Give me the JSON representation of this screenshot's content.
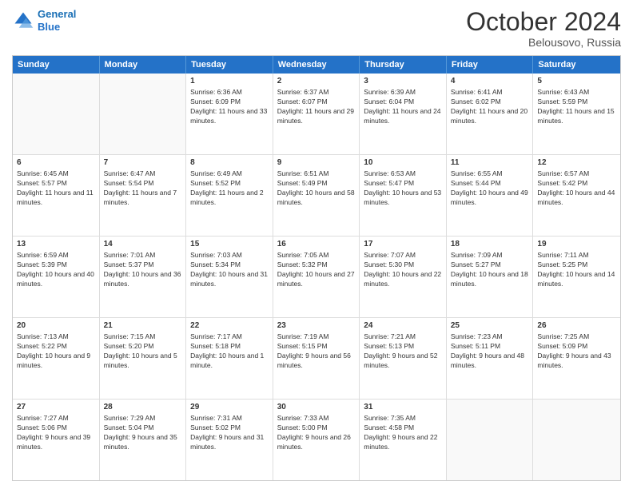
{
  "header": {
    "logo_line1": "General",
    "logo_line2": "Blue",
    "month": "October 2024",
    "location": "Belousovo, Russia"
  },
  "days_of_week": [
    "Sunday",
    "Monday",
    "Tuesday",
    "Wednesday",
    "Thursday",
    "Friday",
    "Saturday"
  ],
  "weeks": [
    [
      {
        "day": "",
        "sunrise": "",
        "sunset": "",
        "daylight": "",
        "empty": true
      },
      {
        "day": "",
        "sunrise": "",
        "sunset": "",
        "daylight": "",
        "empty": true
      },
      {
        "day": "1",
        "sunrise": "Sunrise: 6:36 AM",
        "sunset": "Sunset: 6:09 PM",
        "daylight": "Daylight: 11 hours and 33 minutes."
      },
      {
        "day": "2",
        "sunrise": "Sunrise: 6:37 AM",
        "sunset": "Sunset: 6:07 PM",
        "daylight": "Daylight: 11 hours and 29 minutes."
      },
      {
        "day": "3",
        "sunrise": "Sunrise: 6:39 AM",
        "sunset": "Sunset: 6:04 PM",
        "daylight": "Daylight: 11 hours and 24 minutes."
      },
      {
        "day": "4",
        "sunrise": "Sunrise: 6:41 AM",
        "sunset": "Sunset: 6:02 PM",
        "daylight": "Daylight: 11 hours and 20 minutes."
      },
      {
        "day": "5",
        "sunrise": "Sunrise: 6:43 AM",
        "sunset": "Sunset: 5:59 PM",
        "daylight": "Daylight: 11 hours and 15 minutes."
      }
    ],
    [
      {
        "day": "6",
        "sunrise": "Sunrise: 6:45 AM",
        "sunset": "Sunset: 5:57 PM",
        "daylight": "Daylight: 11 hours and 11 minutes."
      },
      {
        "day": "7",
        "sunrise": "Sunrise: 6:47 AM",
        "sunset": "Sunset: 5:54 PM",
        "daylight": "Daylight: 11 hours and 7 minutes."
      },
      {
        "day": "8",
        "sunrise": "Sunrise: 6:49 AM",
        "sunset": "Sunset: 5:52 PM",
        "daylight": "Daylight: 11 hours and 2 minutes."
      },
      {
        "day": "9",
        "sunrise": "Sunrise: 6:51 AM",
        "sunset": "Sunset: 5:49 PM",
        "daylight": "Daylight: 10 hours and 58 minutes."
      },
      {
        "day": "10",
        "sunrise": "Sunrise: 6:53 AM",
        "sunset": "Sunset: 5:47 PM",
        "daylight": "Daylight: 10 hours and 53 minutes."
      },
      {
        "day": "11",
        "sunrise": "Sunrise: 6:55 AM",
        "sunset": "Sunset: 5:44 PM",
        "daylight": "Daylight: 10 hours and 49 minutes."
      },
      {
        "day": "12",
        "sunrise": "Sunrise: 6:57 AM",
        "sunset": "Sunset: 5:42 PM",
        "daylight": "Daylight: 10 hours and 44 minutes."
      }
    ],
    [
      {
        "day": "13",
        "sunrise": "Sunrise: 6:59 AM",
        "sunset": "Sunset: 5:39 PM",
        "daylight": "Daylight: 10 hours and 40 minutes."
      },
      {
        "day": "14",
        "sunrise": "Sunrise: 7:01 AM",
        "sunset": "Sunset: 5:37 PM",
        "daylight": "Daylight: 10 hours and 36 minutes."
      },
      {
        "day": "15",
        "sunrise": "Sunrise: 7:03 AM",
        "sunset": "Sunset: 5:34 PM",
        "daylight": "Daylight: 10 hours and 31 minutes."
      },
      {
        "day": "16",
        "sunrise": "Sunrise: 7:05 AM",
        "sunset": "Sunset: 5:32 PM",
        "daylight": "Daylight: 10 hours and 27 minutes."
      },
      {
        "day": "17",
        "sunrise": "Sunrise: 7:07 AM",
        "sunset": "Sunset: 5:30 PM",
        "daylight": "Daylight: 10 hours and 22 minutes."
      },
      {
        "day": "18",
        "sunrise": "Sunrise: 7:09 AM",
        "sunset": "Sunset: 5:27 PM",
        "daylight": "Daylight: 10 hours and 18 minutes."
      },
      {
        "day": "19",
        "sunrise": "Sunrise: 7:11 AM",
        "sunset": "Sunset: 5:25 PM",
        "daylight": "Daylight: 10 hours and 14 minutes."
      }
    ],
    [
      {
        "day": "20",
        "sunrise": "Sunrise: 7:13 AM",
        "sunset": "Sunset: 5:22 PM",
        "daylight": "Daylight: 10 hours and 9 minutes."
      },
      {
        "day": "21",
        "sunrise": "Sunrise: 7:15 AM",
        "sunset": "Sunset: 5:20 PM",
        "daylight": "Daylight: 10 hours and 5 minutes."
      },
      {
        "day": "22",
        "sunrise": "Sunrise: 7:17 AM",
        "sunset": "Sunset: 5:18 PM",
        "daylight": "Daylight: 10 hours and 1 minute."
      },
      {
        "day": "23",
        "sunrise": "Sunrise: 7:19 AM",
        "sunset": "Sunset: 5:15 PM",
        "daylight": "Daylight: 9 hours and 56 minutes."
      },
      {
        "day": "24",
        "sunrise": "Sunrise: 7:21 AM",
        "sunset": "Sunset: 5:13 PM",
        "daylight": "Daylight: 9 hours and 52 minutes."
      },
      {
        "day": "25",
        "sunrise": "Sunrise: 7:23 AM",
        "sunset": "Sunset: 5:11 PM",
        "daylight": "Daylight: 9 hours and 48 minutes."
      },
      {
        "day": "26",
        "sunrise": "Sunrise: 7:25 AM",
        "sunset": "Sunset: 5:09 PM",
        "daylight": "Daylight: 9 hours and 43 minutes."
      }
    ],
    [
      {
        "day": "27",
        "sunrise": "Sunrise: 7:27 AM",
        "sunset": "Sunset: 5:06 PM",
        "daylight": "Daylight: 9 hours and 39 minutes."
      },
      {
        "day": "28",
        "sunrise": "Sunrise: 7:29 AM",
        "sunset": "Sunset: 5:04 PM",
        "daylight": "Daylight: 9 hours and 35 minutes."
      },
      {
        "day": "29",
        "sunrise": "Sunrise: 7:31 AM",
        "sunset": "Sunset: 5:02 PM",
        "daylight": "Daylight: 9 hours and 31 minutes."
      },
      {
        "day": "30",
        "sunrise": "Sunrise: 7:33 AM",
        "sunset": "Sunset: 5:00 PM",
        "daylight": "Daylight: 9 hours and 26 minutes."
      },
      {
        "day": "31",
        "sunrise": "Sunrise: 7:35 AM",
        "sunset": "Sunset: 4:58 PM",
        "daylight": "Daylight: 9 hours and 22 minutes."
      },
      {
        "day": "",
        "sunrise": "",
        "sunset": "",
        "daylight": "",
        "empty": true
      },
      {
        "day": "",
        "sunrise": "",
        "sunset": "",
        "daylight": "",
        "empty": true
      }
    ]
  ]
}
